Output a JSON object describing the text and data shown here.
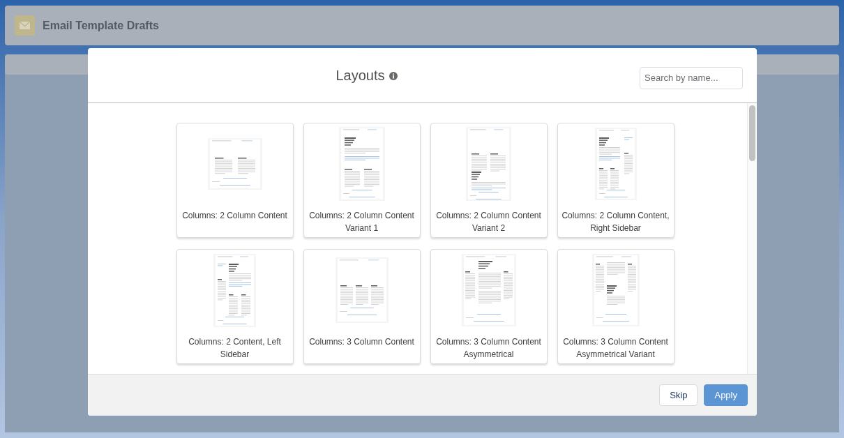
{
  "page": {
    "title": "Email Template Drafts"
  },
  "modal": {
    "title": "Layouts",
    "search": {
      "placeholder": "Search by name..."
    },
    "layouts": [
      {
        "name": "Columns: 2 Column Content",
        "kind": "twocol"
      },
      {
        "name": "Columns: 2 Column Content Variant 1",
        "kind": "twocolv1"
      },
      {
        "name": "Columns: 2 Column Content Variant 2",
        "kind": "twocolv2"
      },
      {
        "name": "Columns: 2 Column Content, Right Sidebar",
        "kind": "rightsidebar"
      },
      {
        "name": "Columns: 2 Content, Left Sidebar",
        "kind": "leftsidebar"
      },
      {
        "name": "Columns: 3 Column Content",
        "kind": "threecol"
      },
      {
        "name": "Columns: 3 Column Content Asymmetrical",
        "kind": "threecolasym"
      },
      {
        "name": "Columns: 3 Column Content Asymmetrical Variant",
        "kind": "threecolasymv"
      }
    ],
    "buttons": [
      {
        "label": "Skip",
        "kind": "neutral"
      },
      {
        "label": "Apply",
        "kind": "brand"
      }
    ]
  }
}
